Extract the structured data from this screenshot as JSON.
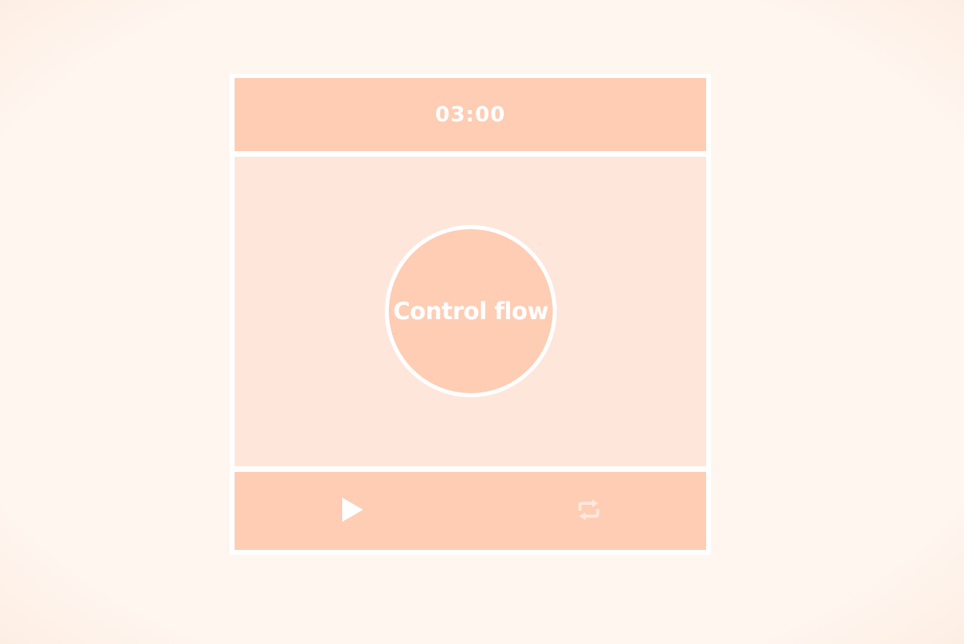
{
  "timer": {
    "display": "03:00"
  },
  "main": {
    "topic": "Control flow"
  },
  "controls": {
    "play_icon": "play-icon",
    "repeat_icon": "repeat-icon"
  },
  "colors": {
    "background": "#fff6f0",
    "panel_accent": "#fecdb4",
    "panel_light": "#fee6db",
    "border": "#ffffff",
    "repeat_icon": "#fee6db"
  }
}
